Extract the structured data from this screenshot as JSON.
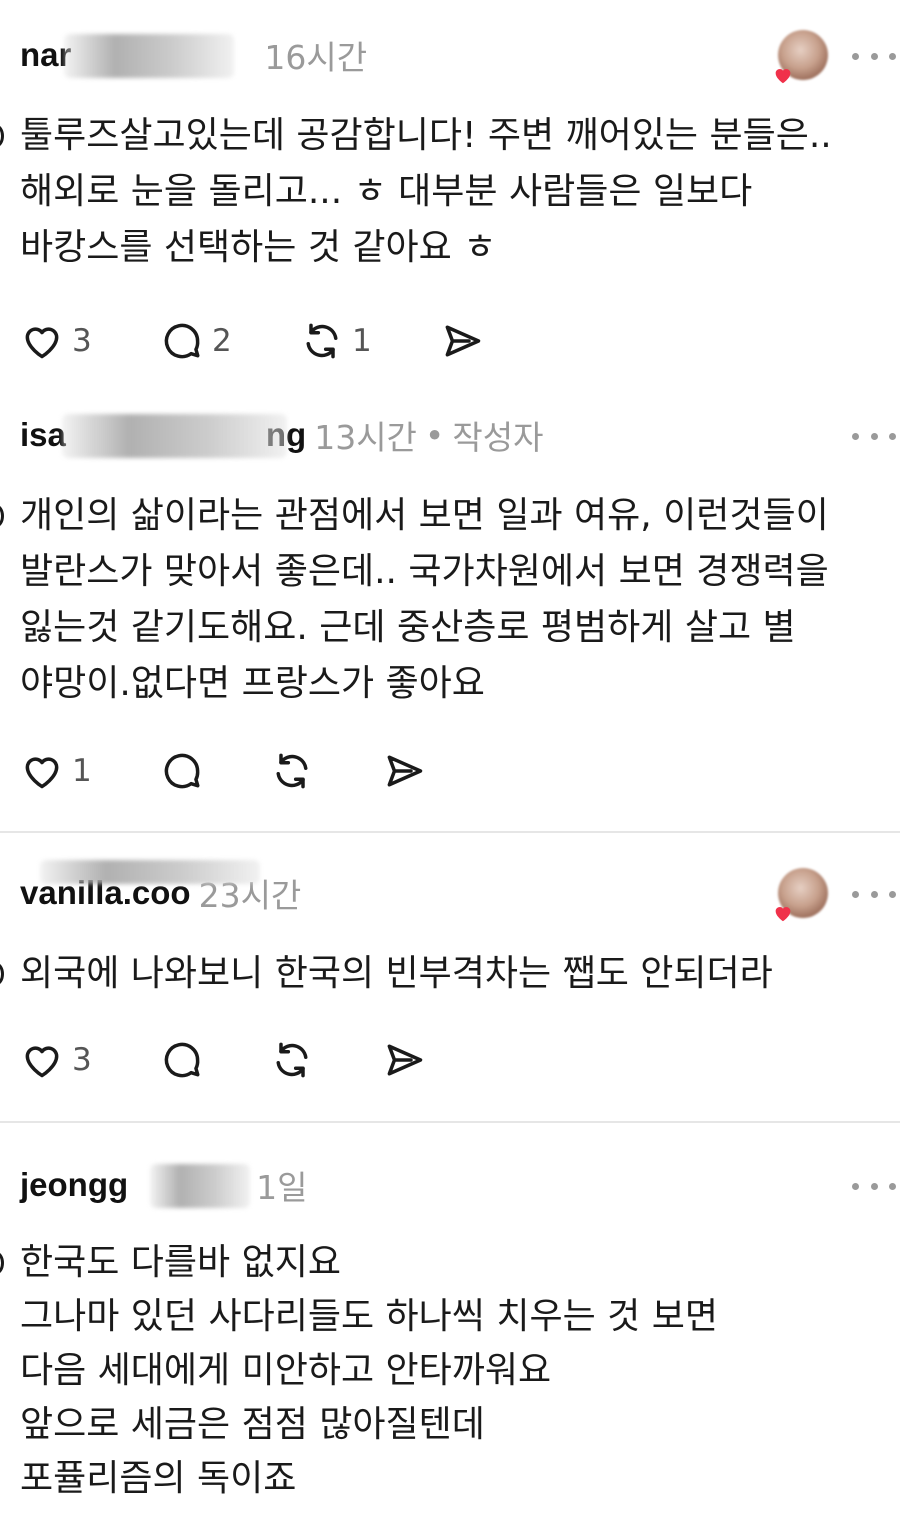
{
  "comments": [
    {
      "username": "nar",
      "time": "16시간",
      "author_tag": "",
      "body_lines": [
        "툴루즈살고있는데 공감합니다! 주변 깨어있는 분들은..",
        "해외로 눈을 돌리고... ㅎ 대부분 사람들은 일보다",
        "바캉스를 선택하는 것 같아요 ㅎ"
      ],
      "likes": "3",
      "replies": "2",
      "reposts": "1",
      "author_liked": true
    },
    {
      "username": "isa",
      "username_tail": "ng",
      "time": "13시간",
      "author_sep": "•",
      "author_tag": "작성자",
      "body_lines": [
        "개인의 삶이라는 관점에서 보면 일과 여유,  이런것들이",
        "발란스가 맞아서 좋은데.. 국가차원에서 보면 경쟁력을",
        "잃는것 같기도해요. 근데 중산층로 평범하게 살고 별",
        "야망이.없다면 프랑스가 좋아요"
      ],
      "likes": "1",
      "replies": "",
      "reposts": "",
      "author_liked": false
    },
    {
      "username": "vanilla.co",
      "username_tail": "o",
      "time": "23시간",
      "author_tag": "",
      "body_lines": [
        "외국에 나와보니 한국의 빈부격차는 쨉도 안되더라"
      ],
      "likes": "3",
      "replies": "",
      "reposts": "",
      "author_liked": true
    },
    {
      "username": "jeongg",
      "username_tail": "",
      "time": "1일",
      "author_tag": "",
      "body_lines": [
        "한국도 다를바 없지요",
        "그나마 있던 사다리들도 하나씩 치우는 것 보면",
        "다음 세대에게 미안하고 안타까워요",
        "앞으로 세금은 점점 많아질텐데",
        "포퓰리즘의 독이죠"
      ],
      "likes": "",
      "replies": "",
      "reposts": "",
      "author_liked": false
    }
  ],
  "icons": {
    "like": "heart-icon",
    "reply": "comment-bubble-icon",
    "repost": "repost-icon",
    "share": "send-icon",
    "more": "more-dots-icon"
  },
  "colors": {
    "text": "#1a1a1a",
    "meta": "#9a9a9a",
    "heart_red": "#f0314a",
    "divider": "#e6e6e6"
  }
}
